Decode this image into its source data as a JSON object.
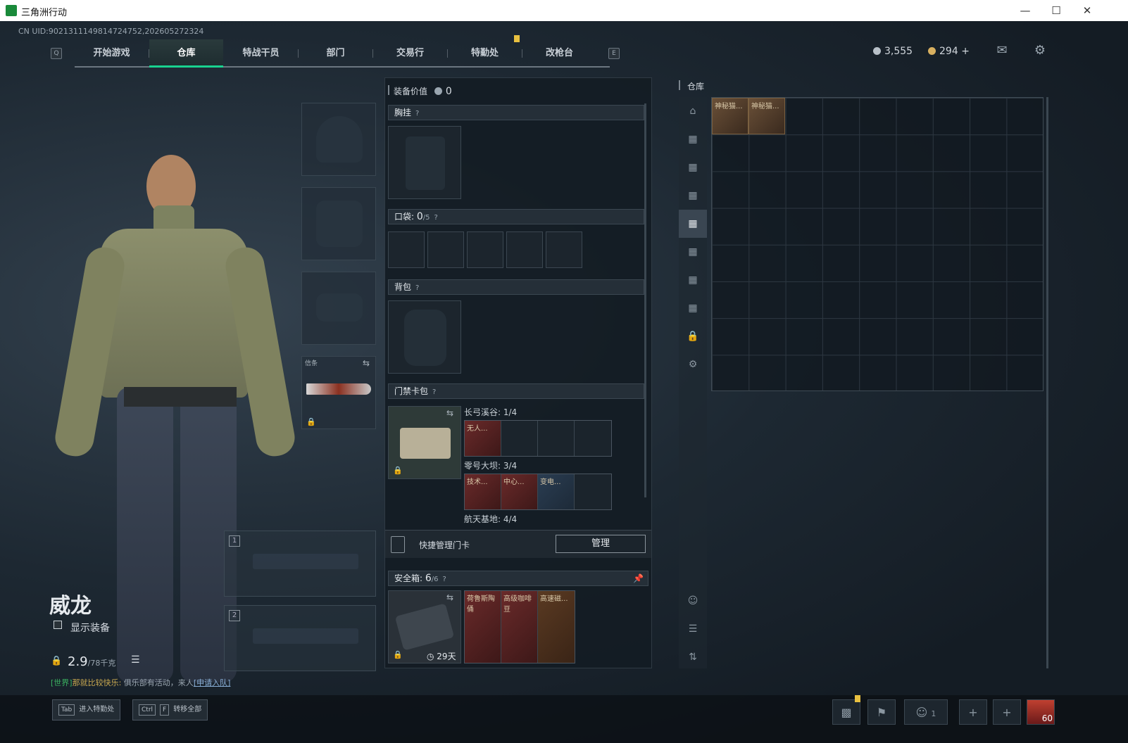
{
  "window": {
    "title": "三角洲行动"
  },
  "uid": "CN UID:9021311149814724752,202605272324",
  "nav": {
    "key_left": "Q",
    "key_right": "E",
    "tabs": [
      "开始游戏",
      "仓库",
      "特战干员",
      "部门",
      "交易行",
      "特勤处",
      "改枪台"
    ],
    "active": "仓库"
  },
  "currency": {
    "silver": "3,555",
    "gold": "294",
    "plus": "+"
  },
  "gear": {
    "melee_label": "信条"
  },
  "weapon_slots": [
    "1",
    "2"
  ],
  "character": {
    "name": "威龙",
    "show_gear": "显示装备",
    "weight": "2.9",
    "weight_max": "/78千克"
  },
  "chat": {
    "channel": "[世界]",
    "sender": "那就比较快乐:",
    "message": " 俱乐部有活动，来人",
    "link": "[申请入队]"
  },
  "loadout": {
    "value_label": "装备价值",
    "value": "0",
    "chest": "胸挂",
    "pocket": "口袋:",
    "pocket_count": "0",
    "pocket_max": "/5",
    "backpack": "背包",
    "keycard_bag": "门禁卡包",
    "maps": [
      {
        "name": "长弓溪谷: 1/4",
        "items": [
          "无人..."
        ]
      },
      {
        "name": "零号大坝: 3/4",
        "items": [
          "技术...",
          "中心...",
          "变电..."
        ]
      },
      {
        "name": "航天基地: 4/4",
        "items": []
      }
    ],
    "quick_manage": "快捷管理门卡",
    "manage_btn": "管理",
    "safebox": "安全箱:",
    "safebox_count": "6",
    "safebox_max": "/6",
    "safebox_days": "29天",
    "safebox_items": [
      "荷鲁斯陶俑",
      "高级咖啡豆",
      "高速磁..."
    ],
    "help": "?"
  },
  "warehouse": {
    "title": "仓库",
    "items": [
      "神秘猫...",
      "神秘猫..."
    ]
  },
  "bottom": {
    "hint1_key": "Tab",
    "hint1": "进入特勤处",
    "hint2_key1": "Ctrl",
    "hint2_key2": "F",
    "hint2": "转移全部",
    "friends": "1",
    "level": "60"
  },
  "colors": {
    "accent": "#19d28f",
    "bg": "#141c24"
  }
}
